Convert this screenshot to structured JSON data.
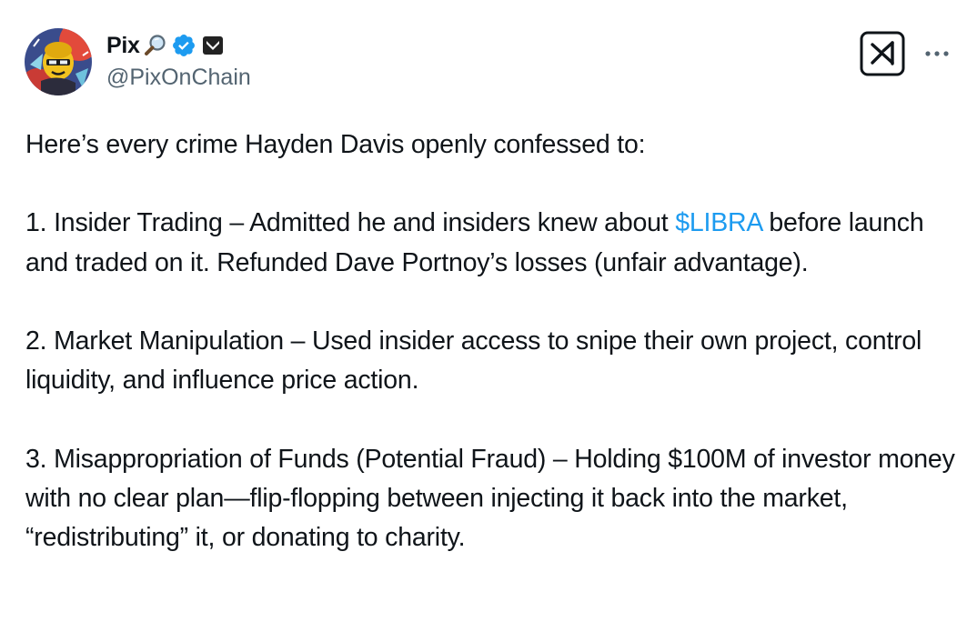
{
  "author": {
    "display_name": "Pix",
    "handle": "@PixOnChain"
  },
  "colors": {
    "text": "#0f1419",
    "secondary": "#536471",
    "link": "#1d9bf0",
    "verified": "#1d9bf0"
  },
  "icons": {
    "name_badges": [
      "magnifying-glass-icon",
      "verified-badge-icon",
      "affiliate-badge-icon"
    ],
    "grok": "grok-icon",
    "more": "more-icon"
  },
  "tweet": {
    "intro": "Here’s every crime Hayden Davis openly confessed to:",
    "item1": {
      "before": "1. Insider Trading – Admitted he and insiders knew about ",
      "cashtag": "$LIBRA",
      "after": " before launch and traded on it. Refunded Dave Portnoy’s losses (unfair advantage)."
    },
    "item2": "2. Market Manipulation – Used insider access to snipe their own project, control liquidity, and influence price action.",
    "item3": "3. Misappropriation of Funds (Potential Fraud) – Holding $100M of investor money with no clear plan—flip-flopping between injecting it back into the market, “redistributing” it, or donating to charity."
  }
}
